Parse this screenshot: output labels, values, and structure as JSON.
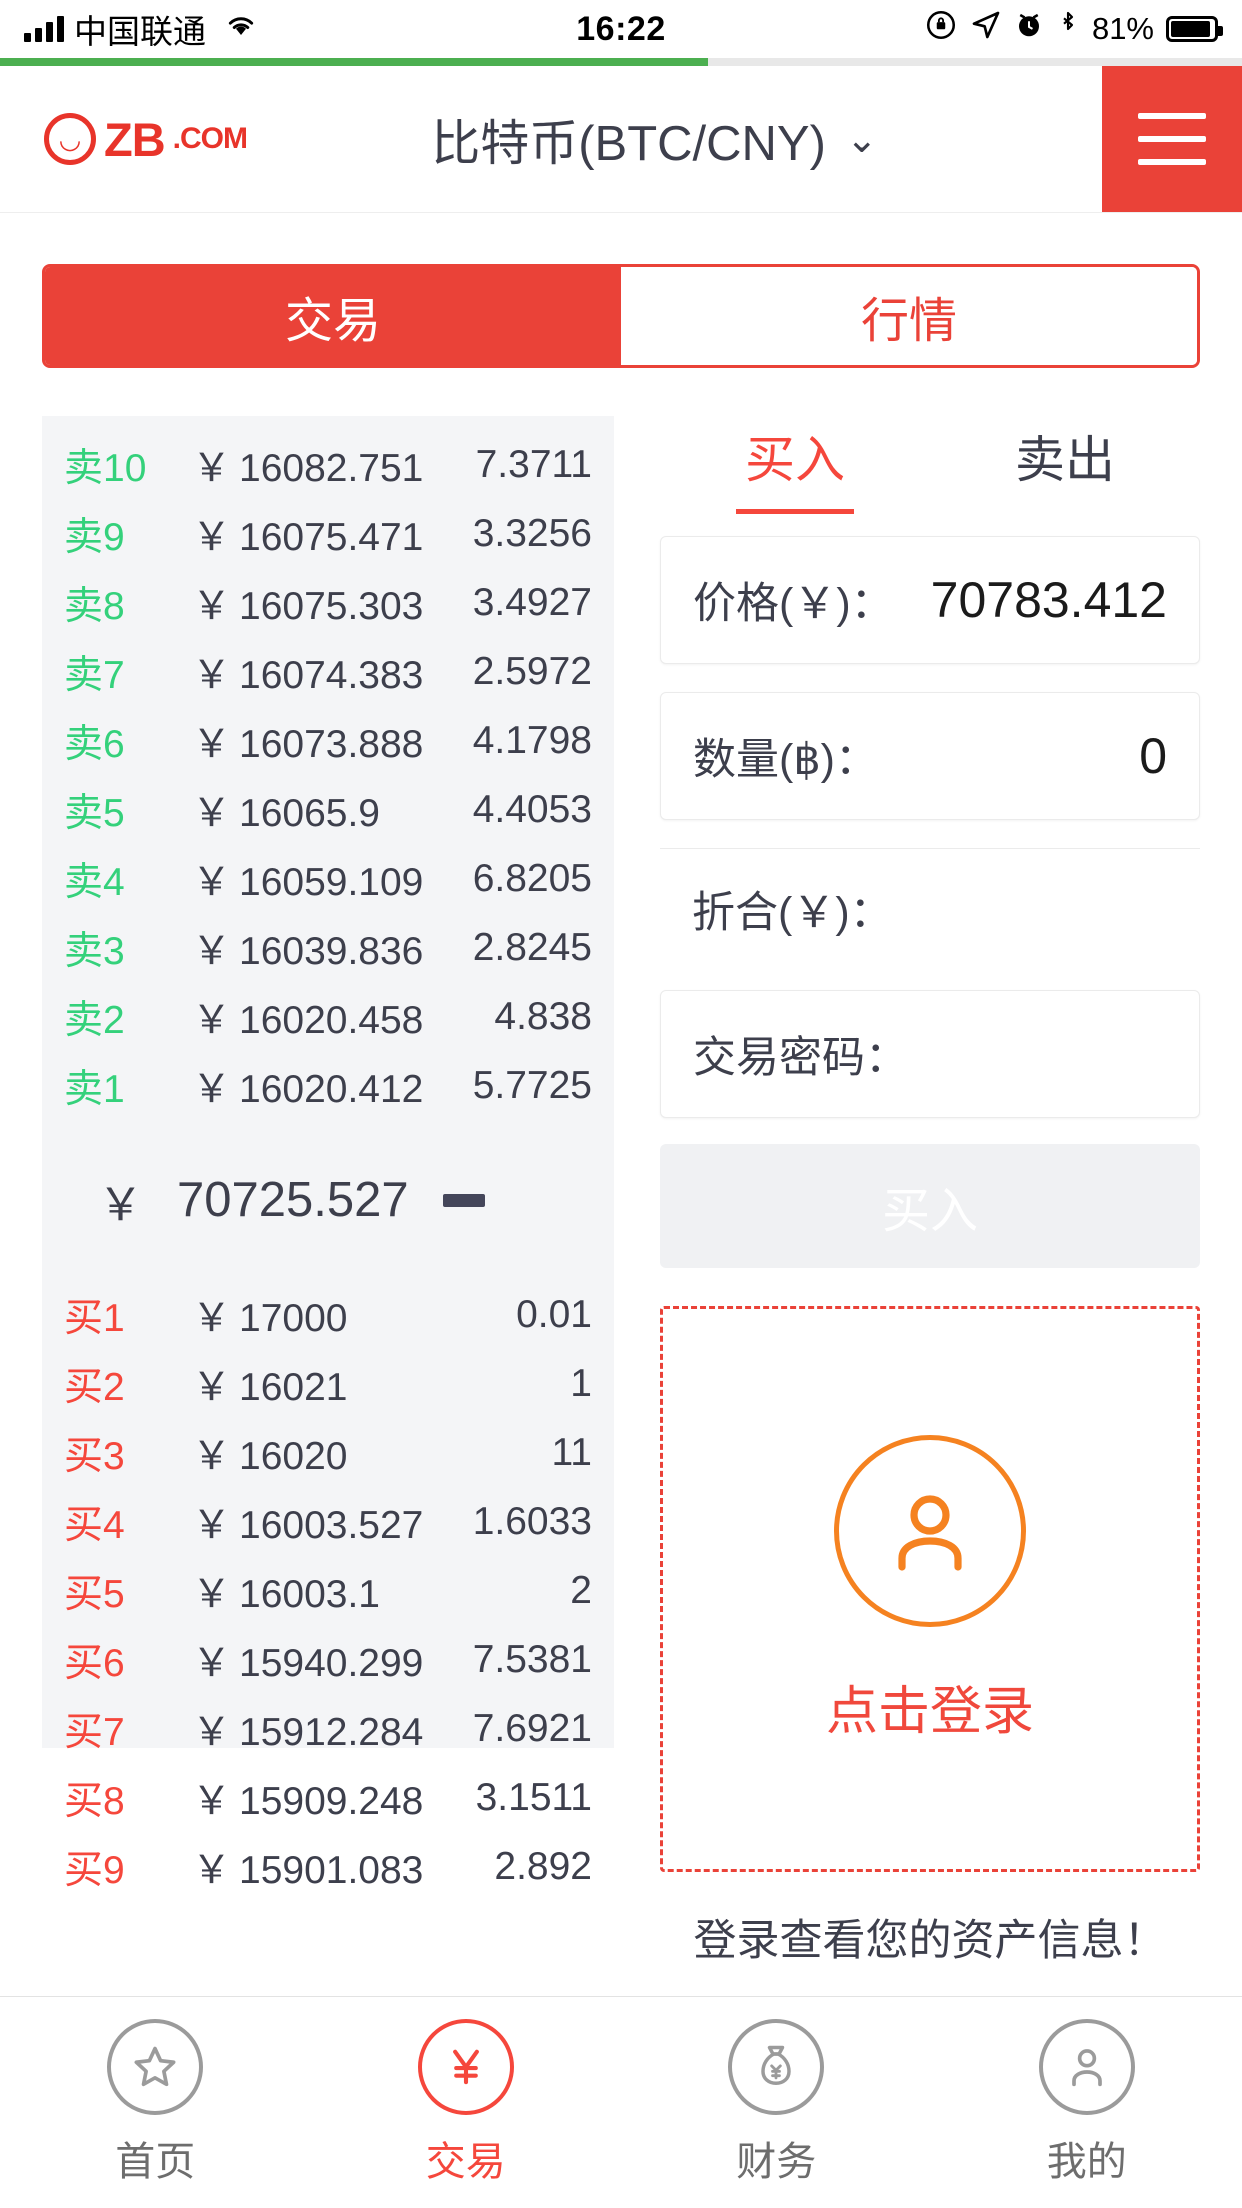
{
  "statusbar": {
    "carrier": "中国联通",
    "time": "16:22",
    "battery": "81%",
    "icons": [
      "signal-bars-icon",
      "wifi-icon",
      "rotation-lock-icon",
      "location-arrow-icon",
      "alarm-clock-icon",
      "bluetooth-icon",
      "battery-icon"
    ]
  },
  "header": {
    "logo_text": "ZB",
    "logo_suffix": ".COM",
    "pair": "比特币(BTC/CNY)",
    "chevron": "⌄",
    "menu_icon": "hamburger-menu-icon"
  },
  "segmented": {
    "active": "交易",
    "inactive": "行情"
  },
  "orderbook": {
    "sells": [
      {
        "tag": "卖",
        "num": "10",
        "price": "16082.751",
        "amount": "7.3711"
      },
      {
        "tag": "卖",
        "num": "9",
        "price": "16075.471",
        "amount": "3.3256"
      },
      {
        "tag": "卖",
        "num": "8",
        "price": "16075.303",
        "amount": "3.4927"
      },
      {
        "tag": "卖",
        "num": "7",
        "price": "16074.383",
        "amount": "2.5972"
      },
      {
        "tag": "卖",
        "num": "6",
        "price": "16073.888",
        "amount": "4.1798"
      },
      {
        "tag": "卖",
        "num": "5",
        "price": "16065.9",
        "amount": "4.4053"
      },
      {
        "tag": "卖",
        "num": "4",
        "price": "16059.109",
        "amount": "6.8205"
      },
      {
        "tag": "卖",
        "num": "3",
        "price": "16039.836",
        "amount": "2.8245"
      },
      {
        "tag": "卖",
        "num": "2",
        "price": "16020.458",
        "amount": "4.838"
      },
      {
        "tag": "卖",
        "num": "1",
        "price": "16020.412",
        "amount": "5.7725"
      }
    ],
    "last_price": "70725.527",
    "last_price_symbol": "￥",
    "trend_icon": "flat-dash-icon",
    "buys": [
      {
        "tag": "买",
        "num": "1",
        "price": "17000",
        "amount": "0.01"
      },
      {
        "tag": "买",
        "num": "2",
        "price": "16021",
        "amount": "1"
      },
      {
        "tag": "买",
        "num": "3",
        "price": "16020",
        "amount": "11"
      },
      {
        "tag": "买",
        "num": "4",
        "price": "16003.527",
        "amount": "1.6033"
      },
      {
        "tag": "买",
        "num": "5",
        "price": "16003.1",
        "amount": "2"
      },
      {
        "tag": "买",
        "num": "6",
        "price": "15940.299",
        "amount": "7.5381"
      },
      {
        "tag": "买",
        "num": "7",
        "price": "15912.284",
        "amount": "7.6921"
      },
      {
        "tag": "买",
        "num": "8",
        "price": "15909.248",
        "amount": "3.1511"
      },
      {
        "tag": "买",
        "num": "9",
        "price": "15901.083",
        "amount": "2.892"
      }
    ],
    "currency_symbol": "￥"
  },
  "trade_form": {
    "tab_buy": "买入",
    "tab_sell": "卖出",
    "price_label": "价格(￥)：",
    "price_value": "70783.412",
    "amount_label": "数量(฿)：",
    "amount_value": "0",
    "total_label": "折合(￥)：",
    "total_value": "",
    "password_label": "交易密码：",
    "password_value": "",
    "submit_label": "买入"
  },
  "login": {
    "avatar_icon": "user-avatar-icon",
    "cta": "点击登录",
    "hint": "登录查看您的资产信息！"
  },
  "tabbar": {
    "items": [
      {
        "label": "首页",
        "icon": "star-icon",
        "active": false
      },
      {
        "label": "交易",
        "icon": "yuan-exchange-icon",
        "active": true
      },
      {
        "label": "财务",
        "icon": "money-bag-icon",
        "active": false
      },
      {
        "label": "我的",
        "icon": "person-icon",
        "active": false
      }
    ]
  },
  "colors": {
    "brand_red": "#ea4238",
    "sell_green": "#34d17b",
    "buy_red": "#f5473c",
    "orange": "#f58220",
    "loadbar_green": "#4caf50"
  }
}
